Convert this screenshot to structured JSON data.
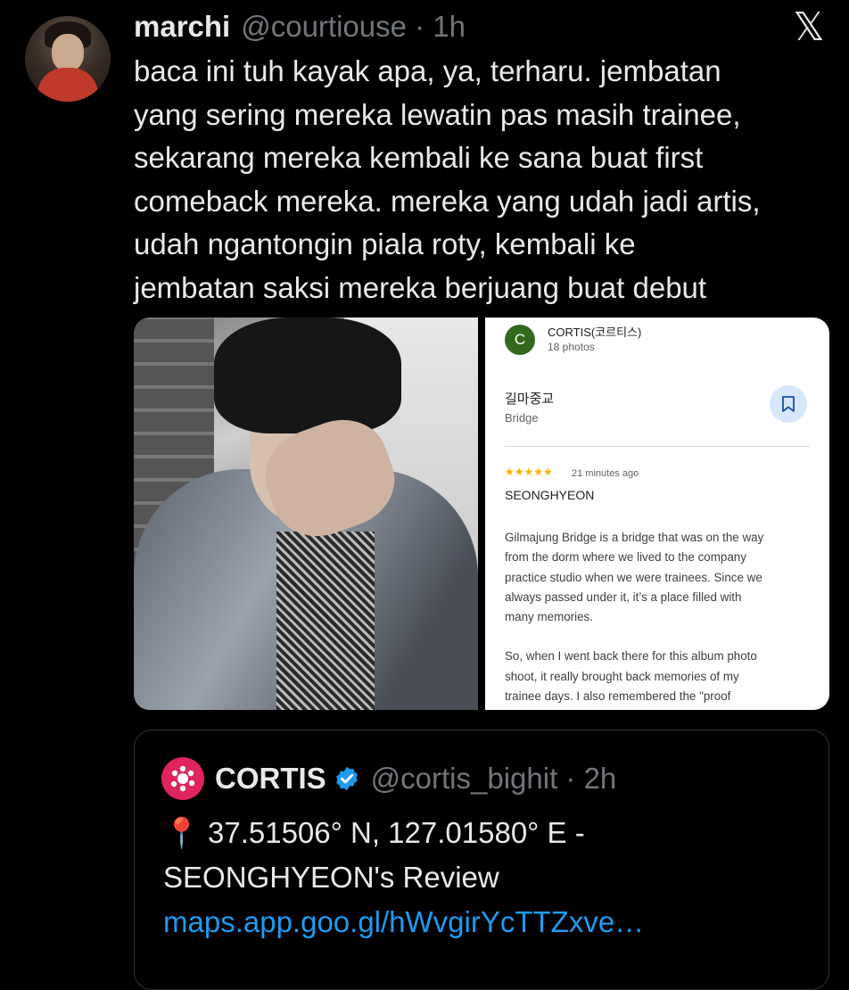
{
  "tweet": {
    "author_name": "marchi",
    "handle_time": "@courtiouse · 1h",
    "lines": [
      "baca ini tuh kayak apa, ya, terharu. jembatan",
      "yang sering mereka lewatin pas masih trainee,",
      "sekarang mereka kembali ke sana buat first",
      "comeback mereka. mereka yang udah jadi artis,",
      "udah ngantongin piala roty, kembali ke",
      "jembatan saksi mereka berjuang buat debut"
    ]
  },
  "brand": {
    "logo": "x-logo-icon",
    "glyph": "𝕏"
  },
  "review_card": {
    "avatar_letter": "C",
    "account": "CORTIS(코르티스)",
    "photos": "18 photos",
    "place_name": "길마중교",
    "place_type": "Bridge",
    "stars": "★★★★★",
    "time": "21 minutes ago",
    "reviewer": "SEONGHYEON",
    "paragraph1": [
      "Gilmajung Bridge is a bridge that was on the way",
      "from the dorm where we lived to the company",
      "practice studio when we were trainees. Since we",
      "always passed under it, it’s a place filled with",
      "many memories."
    ],
    "paragraph2": [
      "So, when I went back there for this album photo",
      "shoot, it really brought back memories of my",
      "trainee days. I also remembered the \"proof"
    ]
  },
  "quoted_tweet": {
    "name": "CORTIS",
    "handle_time": "@cortis_bighit · 2h",
    "pin": "📍",
    "line1": "37.51506° N, 127.01580° E -",
    "line2": "SEONGHYEON's Review",
    "link": "maps.app.goo.gl/hWvgirYcTTZxve…"
  },
  "colors": {
    "background": "#000000",
    "text": "#e7e9ea",
    "muted": "#71767b",
    "link": "#1d9bf0",
    "verified": "#1d9bf0"
  }
}
